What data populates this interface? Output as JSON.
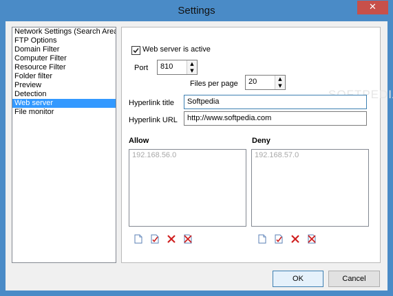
{
  "window": {
    "title": "Settings",
    "close_label": "✕"
  },
  "nav": {
    "items": [
      {
        "label": "Network Settings (Search Area",
        "selected": false
      },
      {
        "label": "FTP Options",
        "selected": false
      },
      {
        "label": "Domain Filter",
        "selected": false
      },
      {
        "label": "Computer Filter",
        "selected": false
      },
      {
        "label": "Resource Filter",
        "selected": false
      },
      {
        "label": "Folder filter",
        "selected": false
      },
      {
        "label": "Preview",
        "selected": false
      },
      {
        "label": "Detection",
        "selected": false
      },
      {
        "label": "Web server",
        "selected": true
      },
      {
        "label": "File monitor",
        "selected": false
      }
    ]
  },
  "web_server": {
    "active_label": "Web server is active",
    "active": true,
    "port_label": "Port",
    "port_value": "810",
    "files_per_page_label": "Files per page",
    "files_per_page_value": "20",
    "hyperlink_title_label": "Hyperlink title",
    "hyperlink_title_value": "Softpedia",
    "hyperlink_url_label": "Hyperlink URL",
    "hyperlink_url_value": "http://www.softpedia.com",
    "allow_label": "Allow",
    "allow_entries": [
      "192.168.56.0"
    ],
    "deny_label": "Deny",
    "deny_entries": [
      "192.168.57.0"
    ]
  },
  "footer": {
    "ok_label": "OK",
    "cancel_label": "Cancel"
  },
  "watermark": "SOFTPEDIA"
}
